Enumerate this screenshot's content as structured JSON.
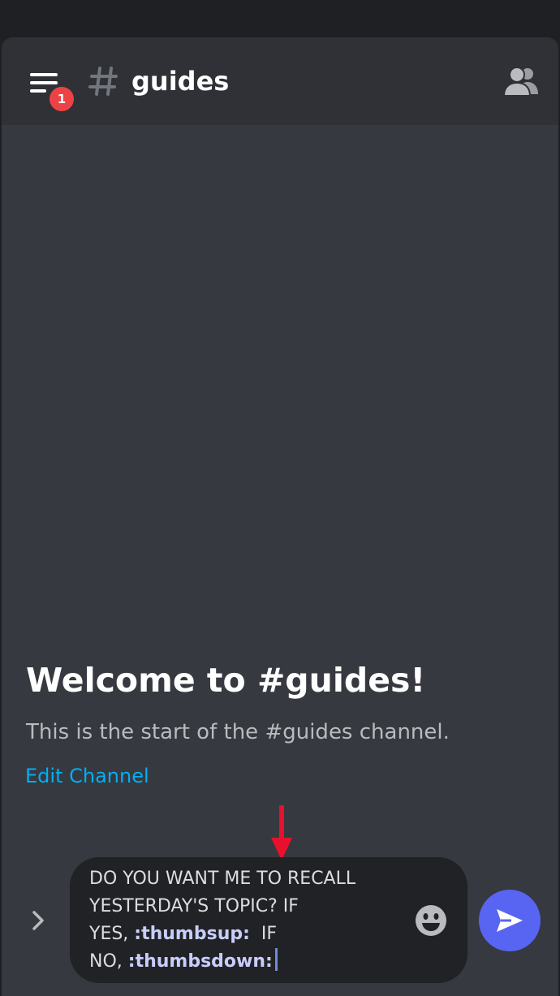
{
  "header": {
    "menu_badge_count": "1",
    "channel_name": "guides",
    "menu_icon": "hamburger-menu-icon",
    "channel_icon": "hash-icon",
    "members_icon": "members-icon"
  },
  "welcome": {
    "title": "Welcome to #guides!",
    "description": "This is the start of the #guides channel.",
    "edit_link": "Edit Channel"
  },
  "composer": {
    "expand_icon": "chevron-right-icon",
    "line1": "DO YOU WANT ME TO RECALL",
    "line2": "YESTERDAY'S TOPIC? IF",
    "line3_prefix": "YES, ",
    "line3_emote": ":thumbsup:",
    "line3_suffix": "  IF",
    "line4_prefix": "NO, ",
    "line4_emote": ":thumbsdown:",
    "emoji_icon": "smiley-emoji-icon",
    "send_icon": "send-icon"
  },
  "colors": {
    "background": "#36393f",
    "header": "#2f3136",
    "composer": "#202225",
    "accent": "#5865f2",
    "badge": "#ed4245",
    "link": "#00aff4",
    "annotation_arrow": "#e8112d"
  }
}
